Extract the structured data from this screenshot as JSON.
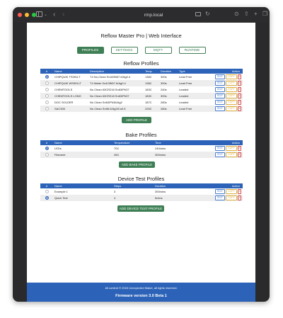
{
  "browser": {
    "url": "rmp.local"
  },
  "app": {
    "title": "Reflow Master Pro | Web Interface"
  },
  "tabs": [
    {
      "label": "PROFILES",
      "active": true
    },
    {
      "label": "SETTINGS",
      "active": false
    },
    {
      "label": "MQTT",
      "active": false
    },
    {
      "label": "RUNTIME",
      "active": false
    }
  ],
  "actions": {
    "edit": "EDIT",
    "copy": "COPY",
    "delete": "X"
  },
  "reflow": {
    "title": "Reflow Profiles",
    "columns": [
      "#",
      "Name",
      "Description",
      "Temp",
      "Duration",
      "Type",
      "Action"
    ],
    "rows": [
      {
        "selected": true,
        "name": "CHIPQUIK TS391LT",
        "description": "T4 No-Clean Sn42/Bi57.6/Ag0.4",
        "temp": "138C",
        "duration": "300s",
        "type": "Lead Free"
      },
      {
        "selected": false,
        "name": "CHIPQUIK WS991LT",
        "description": "T4 Water Sn42/Bi57.6/Ag0.4",
        "temp": "138C",
        "duration": "300s",
        "type": "Lead Free"
      },
      {
        "selected": false,
        "name": "CHEMTOOLS",
        "description": "No Clean 63CR218 Sn63/Pb37",
        "temp": "183C",
        "duration": "240s",
        "type": "Leaded"
      },
      {
        "selected": false,
        "name": "CHEMTOOLS LONG",
        "description": "No Clean 63CR218 Sn63/Pb37",
        "temp": "183C",
        "duration": "300s",
        "type": "Leaded"
      },
      {
        "selected": false,
        "name": "DOC SOLDER",
        "description": "No Clean Sn63/Pb36/Ag2",
        "temp": "187C",
        "duration": "280s",
        "type": "Leaded"
      },
      {
        "selected": false,
        "name": "SAC305",
        "description": "No Clean Sn96.5/Ag3/Cu0.5",
        "temp": "225C",
        "duration": "280s",
        "type": "Lead Free"
      }
    ],
    "add_label": "ADD PROFILE"
  },
  "bake": {
    "title": "Bake Profiles",
    "columns": [
      "#",
      "Name",
      "Temperature",
      "Time",
      "Action"
    ],
    "rows": [
      {
        "selected": true,
        "name": "LEDs",
        "temp": "70C",
        "time": "240mins"
      },
      {
        "selected": false,
        "name": "Filament",
        "temp": "45C",
        "time": "300mins"
      }
    ],
    "add_label": "ADD BAKE PROFILE"
  },
  "device": {
    "title": "Device Test Profiles",
    "columns": [
      "#",
      "Name",
      "Steps",
      "Duration",
      "Action"
    ],
    "rows": [
      {
        "selected": false,
        "name": "Example 1",
        "steps": "3",
        "duration": "300mins"
      },
      {
        "selected": true,
        "name": "Quick Test",
        "steps": "4",
        "duration": "5mins"
      }
    ],
    "add_label": "ADD DEVICE TEST PROFILE"
  },
  "footer": {
    "copyright": "All content © 2024 Unexpected Maker, all rights reserved.",
    "version": "Firmware version 3.0 Beta 1"
  },
  "colors": {
    "header_blue": "#2c63b8",
    "primary_green": "#3f7f55",
    "edit_blue": "#4a7fd0",
    "copy_yellow": "#e0b040",
    "delete_red": "#d24b4b"
  }
}
